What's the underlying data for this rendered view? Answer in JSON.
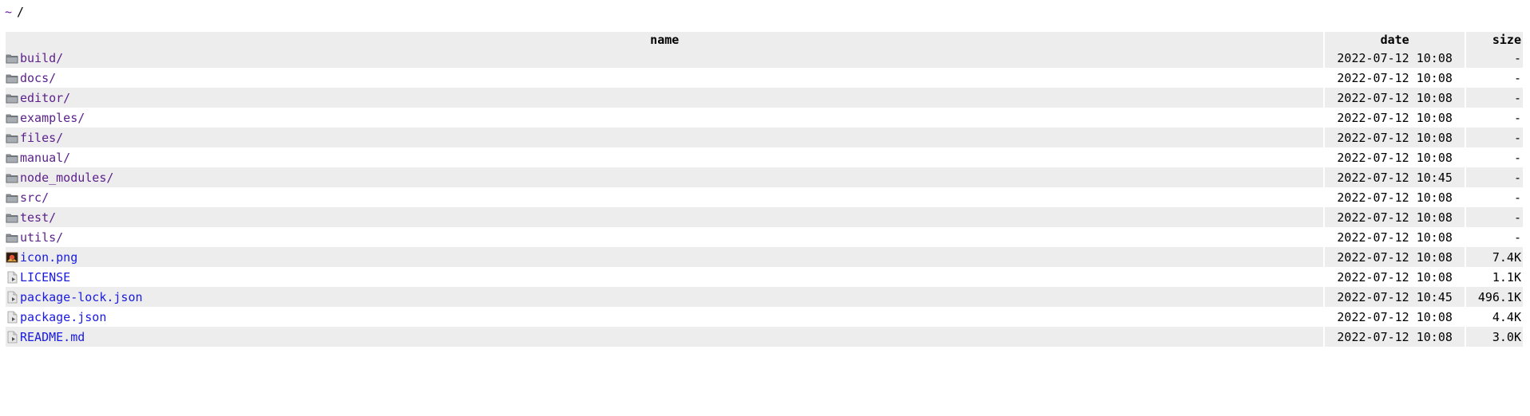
{
  "breadcrumb": {
    "home": "~",
    "path": "/"
  },
  "columns": {
    "name": "name",
    "date": "date",
    "size": "size"
  },
  "entries": [
    {
      "name": "build/",
      "date": "2022-07-12 10:08",
      "size": "-",
      "icon": "folder-icon",
      "kind": "dir"
    },
    {
      "name": "docs/",
      "date": "2022-07-12 10:08",
      "size": "-",
      "icon": "folder-icon",
      "kind": "dir"
    },
    {
      "name": "editor/",
      "date": "2022-07-12 10:08",
      "size": "-",
      "icon": "folder-icon",
      "kind": "dir"
    },
    {
      "name": "examples/",
      "date": "2022-07-12 10:08",
      "size": "-",
      "icon": "folder-icon",
      "kind": "dir"
    },
    {
      "name": "files/",
      "date": "2022-07-12 10:08",
      "size": "-",
      "icon": "folder-icon",
      "kind": "dir"
    },
    {
      "name": "manual/",
      "date": "2022-07-12 10:08",
      "size": "-",
      "icon": "folder-icon",
      "kind": "dir"
    },
    {
      "name": "node_modules/",
      "date": "2022-07-12 10:45",
      "size": "-",
      "icon": "folder-icon",
      "kind": "dir"
    },
    {
      "name": "src/",
      "date": "2022-07-12 10:08",
      "size": "-",
      "icon": "folder-icon",
      "kind": "dir"
    },
    {
      "name": "test/",
      "date": "2022-07-12 10:08",
      "size": "-",
      "icon": "folder-icon",
      "kind": "dir"
    },
    {
      "name": "utils/",
      "date": "2022-07-12 10:08",
      "size": "-",
      "icon": "folder-icon",
      "kind": "dir"
    },
    {
      "name": "icon.png",
      "date": "2022-07-12 10:08",
      "size": "7.4K",
      "icon": "image-file-icon",
      "kind": "file"
    },
    {
      "name": "LICENSE",
      "date": "2022-07-12 10:08",
      "size": "1.1K",
      "icon": "document-icon",
      "kind": "file"
    },
    {
      "name": "package-lock.json",
      "date": "2022-07-12 10:45",
      "size": "496.1K",
      "icon": "document-icon",
      "kind": "file"
    },
    {
      "name": "package.json",
      "date": "2022-07-12 10:08",
      "size": "4.4K",
      "icon": "document-icon",
      "kind": "file"
    },
    {
      "name": "README.md",
      "date": "2022-07-12 10:08",
      "size": "3.0K",
      "icon": "document-icon",
      "kind": "file"
    }
  ],
  "colors": {
    "row_shade": "#ededed",
    "dir_link": "#5a1f8a",
    "file_link": "#1a1ae0",
    "breadcrumb_home": "#6a1fa0"
  }
}
